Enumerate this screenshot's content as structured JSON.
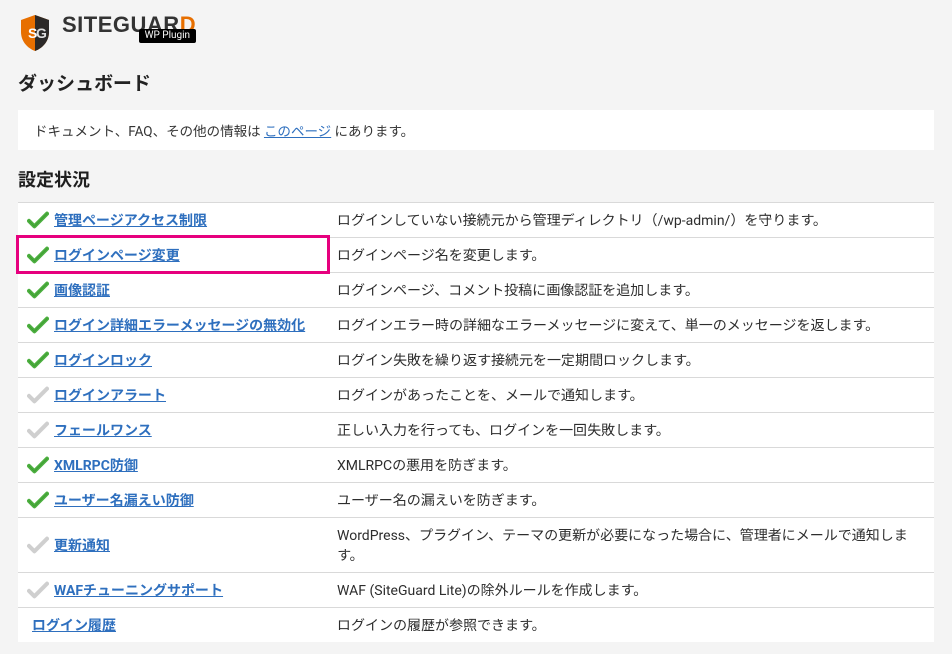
{
  "logo": {
    "text_main": "SITEGUAR",
    "text_accent": "D",
    "sub": "WP Plugin"
  },
  "title": "ダッシュボード",
  "info": {
    "prefix": "ドキュメント、FAQ、その他の情報は ",
    "link": "このページ",
    "suffix": " にあります。"
  },
  "status_heading": "設定状況",
  "rows": [
    {
      "enabled": true,
      "highlight": false,
      "label": "管理ページアクセス制限",
      "desc": "ログインしていない接続元から管理ディレクトリ（/wp-admin/）を守ります。",
      "name": "setting-admin-page-restrict"
    },
    {
      "enabled": true,
      "highlight": true,
      "label": "ログインページ変更",
      "desc": "ログインページ名を変更します。",
      "name": "setting-rename-login"
    },
    {
      "enabled": true,
      "highlight": false,
      "label": "画像認証",
      "desc": "ログインページ、コメント投稿に画像認証を追加します。",
      "name": "setting-captcha"
    },
    {
      "enabled": true,
      "highlight": false,
      "label": "ログイン詳細エラーメッセージの無効化",
      "desc": "ログインエラー時の詳細なエラーメッセージに変えて、単一のメッセージを返します。",
      "name": "setting-disable-login-error"
    },
    {
      "enabled": true,
      "highlight": false,
      "label": "ログインロック",
      "desc": "ログイン失敗を繰り返す接続元を一定期間ロックします。",
      "name": "setting-login-lock"
    },
    {
      "enabled": false,
      "highlight": false,
      "label": "ログインアラート",
      "desc": "ログインがあったことを、メールで通知します。",
      "name": "setting-login-alert"
    },
    {
      "enabled": false,
      "highlight": false,
      "label": "フェールワンス",
      "desc": "正しい入力を行っても、ログインを一回失敗します。",
      "name": "setting-fail-once"
    },
    {
      "enabled": true,
      "highlight": false,
      "label": "XMLRPC防御",
      "desc": "XMLRPCの悪用を防ぎます。",
      "name": "setting-xmlrpc"
    },
    {
      "enabled": true,
      "highlight": false,
      "label": "ユーザー名漏えい防御",
      "desc": "ユーザー名の漏えいを防ぎます。",
      "name": "setting-username-leak"
    },
    {
      "enabled": false,
      "highlight": false,
      "label": "更新通知",
      "desc": "WordPress、プラグイン、テーマの更新が必要になった場合に、管理者にメールで通知します。",
      "name": "setting-update-notify"
    },
    {
      "enabled": false,
      "highlight": false,
      "label": "WAFチューニングサポート",
      "desc": "WAF (SiteGuard Lite)の除外ルールを作成します。",
      "name": "setting-waf-tuning"
    },
    {
      "enabled": null,
      "highlight": false,
      "label": "ログイン履歴",
      "desc": "ログインの履歴が参照できます。",
      "name": "setting-login-history"
    }
  ]
}
